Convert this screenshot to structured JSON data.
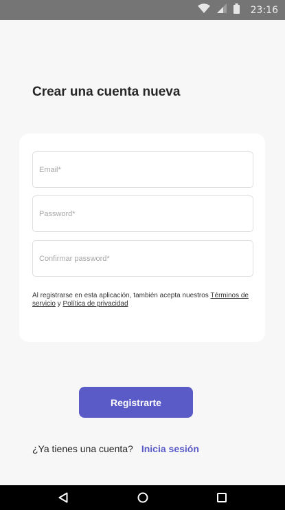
{
  "status_bar": {
    "time": "23:16",
    "icons": [
      "wifi-icon",
      "signal-icon",
      "battery-icon"
    ]
  },
  "page": {
    "title": "Crear una cuenta nueva"
  },
  "form": {
    "email_placeholder": "Email*",
    "password_placeholder": "Password*",
    "confirm_password_placeholder": "Confirmar password*",
    "terms_prefix": "Al registrarse en esta aplicación, también acepta nuestros ",
    "terms_link": "Términos de servicio",
    "terms_and": " y ",
    "privacy_link": "Política de privacidad"
  },
  "actions": {
    "register_label": "Registrarte",
    "login_prompt": "¿Ya tienes una cuenta?",
    "login_link": "Inicia sesión"
  },
  "nav_bar": {
    "icons": [
      "back-icon",
      "home-icon",
      "recent-apps-icon"
    ]
  },
  "colors": {
    "accent": "#5b5bc8",
    "background": "#f7f7f7",
    "status_bar": "#757575",
    "nav_bar": "#000000"
  }
}
